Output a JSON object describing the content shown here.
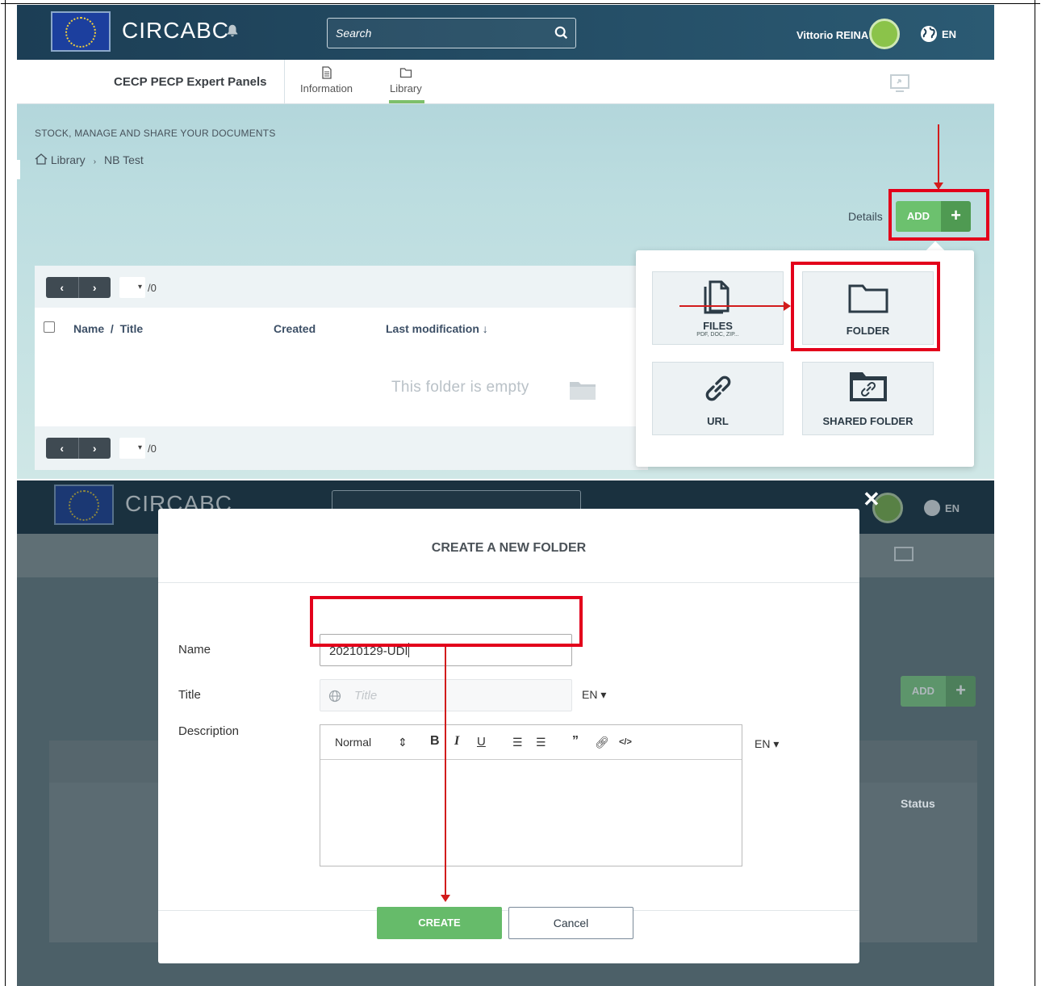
{
  "header": {
    "brand": "CIRCABC",
    "search_placeholder": "Search",
    "user_name": "Vittorio REINA",
    "language": "EN"
  },
  "subnav": {
    "group_name": "CECP PECP Expert Panels",
    "tabs": [
      {
        "label": "Information"
      },
      {
        "label": "Library"
      }
    ]
  },
  "library": {
    "tagline": "STOCK, MANAGE AND SHARE YOUR DOCUMENTS",
    "breadcrumb": [
      "Library",
      "NB Test"
    ],
    "details_label": "Details",
    "add_label": "ADD",
    "page_total": "/0",
    "columns": {
      "name": "Name",
      "title": "Title",
      "created": "Created",
      "last_modification": "Last modification",
      "status": "Status"
    },
    "empty_text": "This folder is empty"
  },
  "add_menu": {
    "files": {
      "label": "FILES",
      "sub": "PDF, DOC, ZIP..."
    },
    "folder": {
      "label": "FOLDER"
    },
    "url": {
      "label": "URL"
    },
    "shared_folder": {
      "label": "SHARED FOLDER"
    }
  },
  "modal": {
    "title": "CREATE A NEW FOLDER",
    "name_label": "Name",
    "name_value": "20210129-UDI",
    "title_label": "Title",
    "title_placeholder": "Title",
    "description_label": "Description",
    "lang": "EN",
    "editor_style": "Normal",
    "create_label": "CREATE",
    "cancel_label": "Cancel"
  },
  "colors": {
    "header_bg": "#1c3e55",
    "accent_green": "#6cc16e",
    "annotation_red": "#e3001b"
  }
}
